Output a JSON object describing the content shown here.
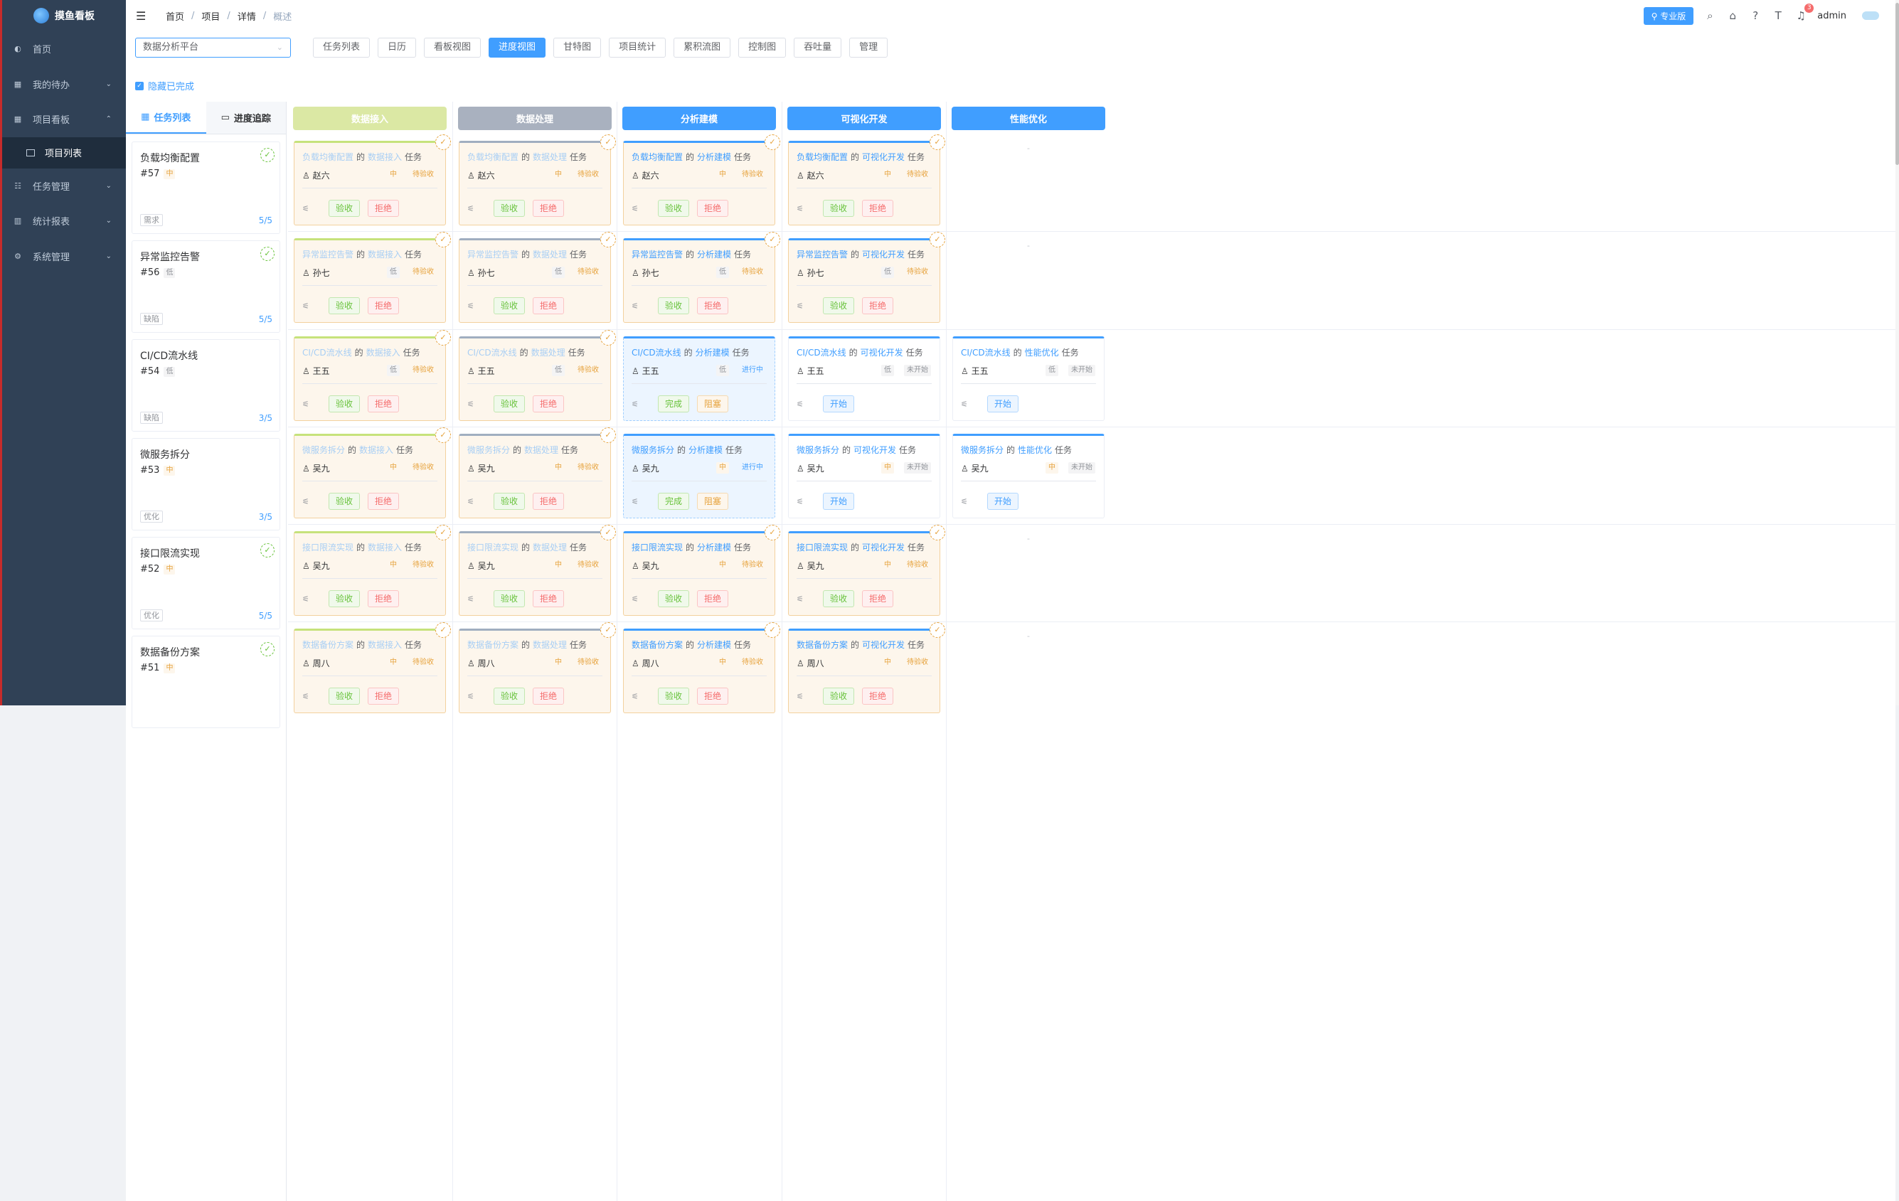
{
  "app": {
    "title": "摸鱼看板"
  },
  "sidebar": {
    "items": [
      {
        "label": "首页",
        "icon": "dashboard-icon",
        "chevron": ""
      },
      {
        "label": "我的待办",
        "icon": "todo-icon",
        "chevron": "⌄"
      },
      {
        "label": "项目看板",
        "icon": "board-icon",
        "chevron": "⌃"
      },
      {
        "label": "任务管理",
        "icon": "task-icon",
        "chevron": "⌄"
      },
      {
        "label": "统计报表",
        "icon": "chart-icon",
        "chevron": "⌄"
      },
      {
        "label": "系统管理",
        "icon": "gear-icon",
        "chevron": "⌄"
      }
    ],
    "sub_item": "项目列表"
  },
  "header": {
    "breadcrumb": [
      "首页",
      "项目",
      "详情",
      "概述"
    ],
    "pro_label": "专业版",
    "notif_count": "3",
    "user": "admin"
  },
  "toolbar": {
    "project_select": "数据分析平台",
    "views": [
      "任务列表",
      "日历",
      "看板视图",
      "进度视图",
      "甘特图",
      "项目统计",
      "累积流图",
      "控制图",
      "吞吐量",
      "管理"
    ],
    "active_view": "进度视图",
    "hide_done_label": "隐藏已完成"
  },
  "left_tabs": {
    "list": "任务列表",
    "track": "进度追踪"
  },
  "tasks": [
    {
      "title": "负载均衡配置",
      "id": "#57",
      "prio": "中",
      "type": "需求",
      "progress": "5/5"
    },
    {
      "title": "异常监控告警",
      "id": "#56",
      "prio": "低",
      "type": "缺陷",
      "progress": "5/5"
    },
    {
      "title": "CI/CD流水线",
      "id": "#54",
      "prio": "低",
      "type": "缺陷",
      "progress": "3/5"
    },
    {
      "title": "微服务拆分",
      "id": "#53",
      "prio": "中",
      "type": "优化",
      "progress": "3/5"
    },
    {
      "title": "接口限流实现",
      "id": "#52",
      "prio": "中",
      "type": "优化",
      "progress": "5/5"
    },
    {
      "title": "数据备份方案",
      "id": "#51",
      "prio": "中",
      "type": "",
      "progress": ""
    }
  ],
  "stages": [
    {
      "label": "数据接入",
      "color": "#dbe8a4"
    },
    {
      "label": "数据处理",
      "color": "#a9b1bf"
    },
    {
      "label": "分析建模",
      "color": "#409eff"
    },
    {
      "label": "可视化开发",
      "color": "#409eff"
    },
    {
      "label": "性能优化",
      "color": "#409eff"
    }
  ],
  "common": {
    "de": "的",
    "task_word": "任务",
    "accept": "验收",
    "reject": "拒绝",
    "start": "开始",
    "finish": "完成",
    "block": "阻塞",
    "status_await": "待验收",
    "status_going": "进行中",
    "status_none": "未开始",
    "empty": "-"
  },
  "grid": [
    {
      "task": "负载均衡配置",
      "who": "赵六",
      "prio": "中",
      "cells": [
        "await",
        "await",
        "await",
        "await",
        "empty"
      ]
    },
    {
      "task": "异常监控告警",
      "who": "孙七",
      "prio": "低",
      "cells": [
        "await",
        "await",
        "await",
        "await",
        "empty"
      ]
    },
    {
      "task": "CI/CD流水线",
      "who": "王五",
      "prio": "低",
      "cells": [
        "await",
        "await",
        "going",
        "none",
        "none"
      ]
    },
    {
      "task": "微服务拆分",
      "who": "吴九",
      "prio": "中",
      "cells": [
        "await",
        "await",
        "going",
        "none",
        "none"
      ]
    },
    {
      "task": "接口限流实现",
      "who": "吴九",
      "prio": "中",
      "cells": [
        "await",
        "await",
        "await",
        "await",
        "empty"
      ]
    },
    {
      "task": "数据备份方案",
      "who": "周八",
      "prio": "中",
      "cells": [
        "await",
        "await",
        "await",
        "await",
        "empty"
      ]
    }
  ]
}
